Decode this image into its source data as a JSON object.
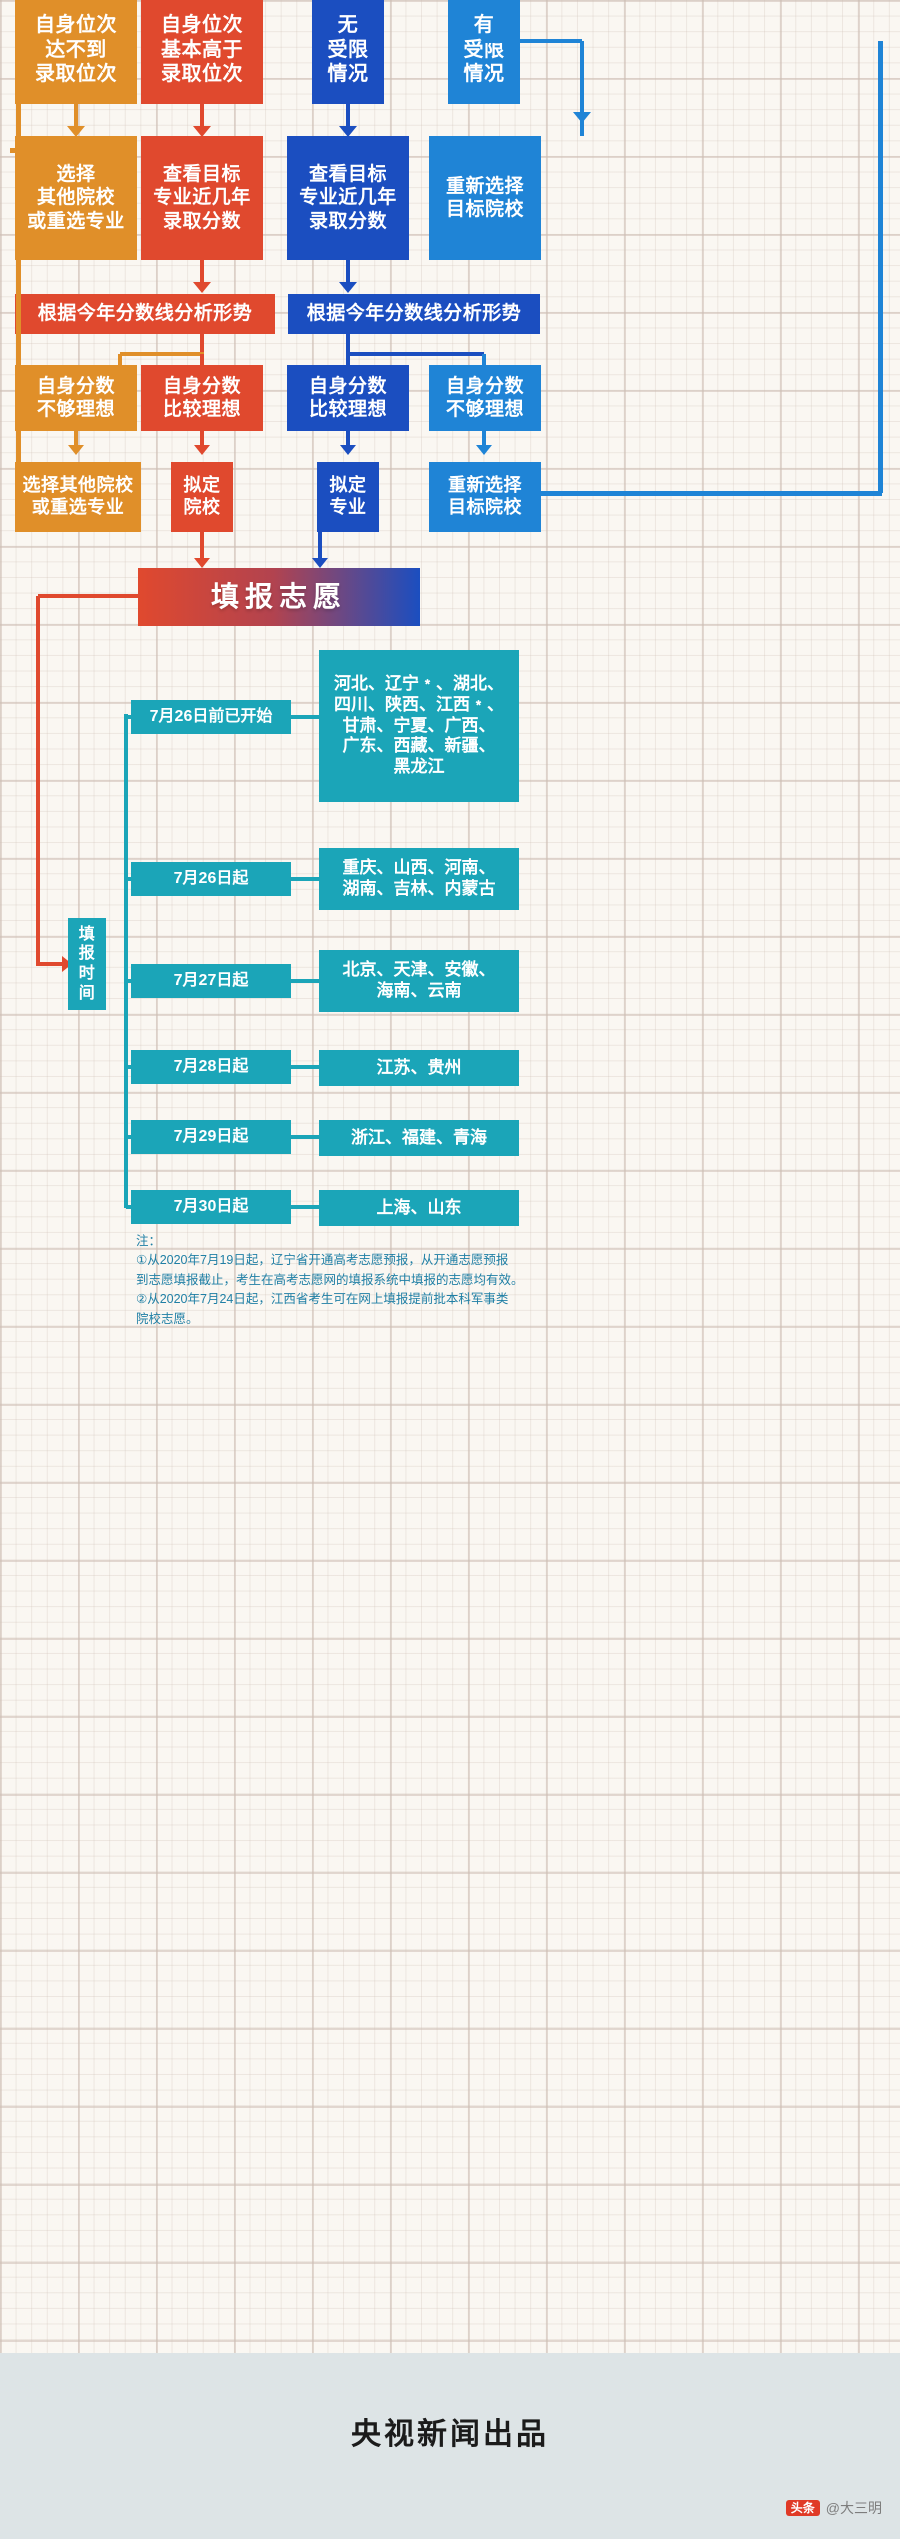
{
  "colors": {
    "orange": "#e08f29",
    "red": "#e0492e",
    "blue_dark": "#1b4ec0",
    "blue_light": "#1f84d6",
    "teal": "#1ba5b8",
    "paper": "#faf7f2",
    "footer_bg": "#dde4e6",
    "note_text": "#1f7fa5"
  },
  "flow": {
    "row1": [
      {
        "label": "自身位次\n达不到\n录取位次",
        "color": "orange"
      },
      {
        "label": "自身位次\n基本高于\n录取位次",
        "color": "red"
      },
      {
        "label": "无\n受限\n情况",
        "color": "blue_dark"
      },
      {
        "label": "有\n受限\n情况",
        "color": "blue_light"
      }
    ],
    "row2": [
      {
        "label": "选择\n其他院校\n或重选专业",
        "color": "orange"
      },
      {
        "label": "查看目标\n专业近几年\n录取分数",
        "color": "red"
      },
      {
        "label": "查看目标\n专业近几年\n录取分数",
        "color": "blue_dark"
      },
      {
        "label": "重新选择\n目标院校",
        "color": "blue_light"
      }
    ],
    "row3": [
      {
        "label": "根据今年分数线分析形势",
        "color": "red"
      },
      {
        "label": "根据今年分数线分析形势",
        "color": "blue_dark"
      }
    ],
    "row4": [
      {
        "label": "自身分数\n不够理想",
        "color": "orange"
      },
      {
        "label": "自身分数\n比较理想",
        "color": "red"
      },
      {
        "label": "自身分数\n比较理想",
        "color": "blue_dark"
      },
      {
        "label": "自身分数\n不够理想",
        "color": "blue_light"
      }
    ],
    "row5": [
      {
        "label": "选择其他院校\n或重选专业",
        "color": "orange"
      },
      {
        "label": "拟定\n院校",
        "color": "red"
      },
      {
        "label": "拟定\n专业",
        "color": "blue_dark"
      },
      {
        "label": "重新选择\n目标院校",
        "color": "blue_light"
      }
    ],
    "banner": {
      "label": "填报志愿"
    }
  },
  "schedule": {
    "root_label": "填\n报\n时\n间",
    "rows": [
      {
        "date": "7月26日前已开始",
        "provinces": "河北、辽宁﹡、湖北、\n四川、陕西、江西﹡、\n甘肃、宁夏、广西、\n广东、西藏、新疆、\n黑龙江"
      },
      {
        "date": "7月26日起",
        "provinces": "重庆、山西、河南、\n湖南、吉林、内蒙古"
      },
      {
        "date": "7月27日起",
        "provinces": "北京、天津、安徽、\n海南、云南"
      },
      {
        "date": "7月28日起",
        "provinces": "江苏、贵州"
      },
      {
        "date": "7月29日起",
        "provinces": "浙江、福建、青海"
      },
      {
        "date": "7月30日起",
        "provinces": "上海、山东"
      }
    ],
    "notes": "注：\n①从2020年7月19日起，辽宁省开通高考志愿预报，从开通志愿预报\n到志愿填报截止，考生在高考志愿网的填报系统中填报的志愿均有效。\n②从2020年7月24日起，江西省考生可在网上填报提前批本科军事类\n院校志愿。"
  },
  "footer": {
    "title": "央视新闻出品",
    "credit_badge": "头条",
    "credit_text": "@大三明"
  }
}
